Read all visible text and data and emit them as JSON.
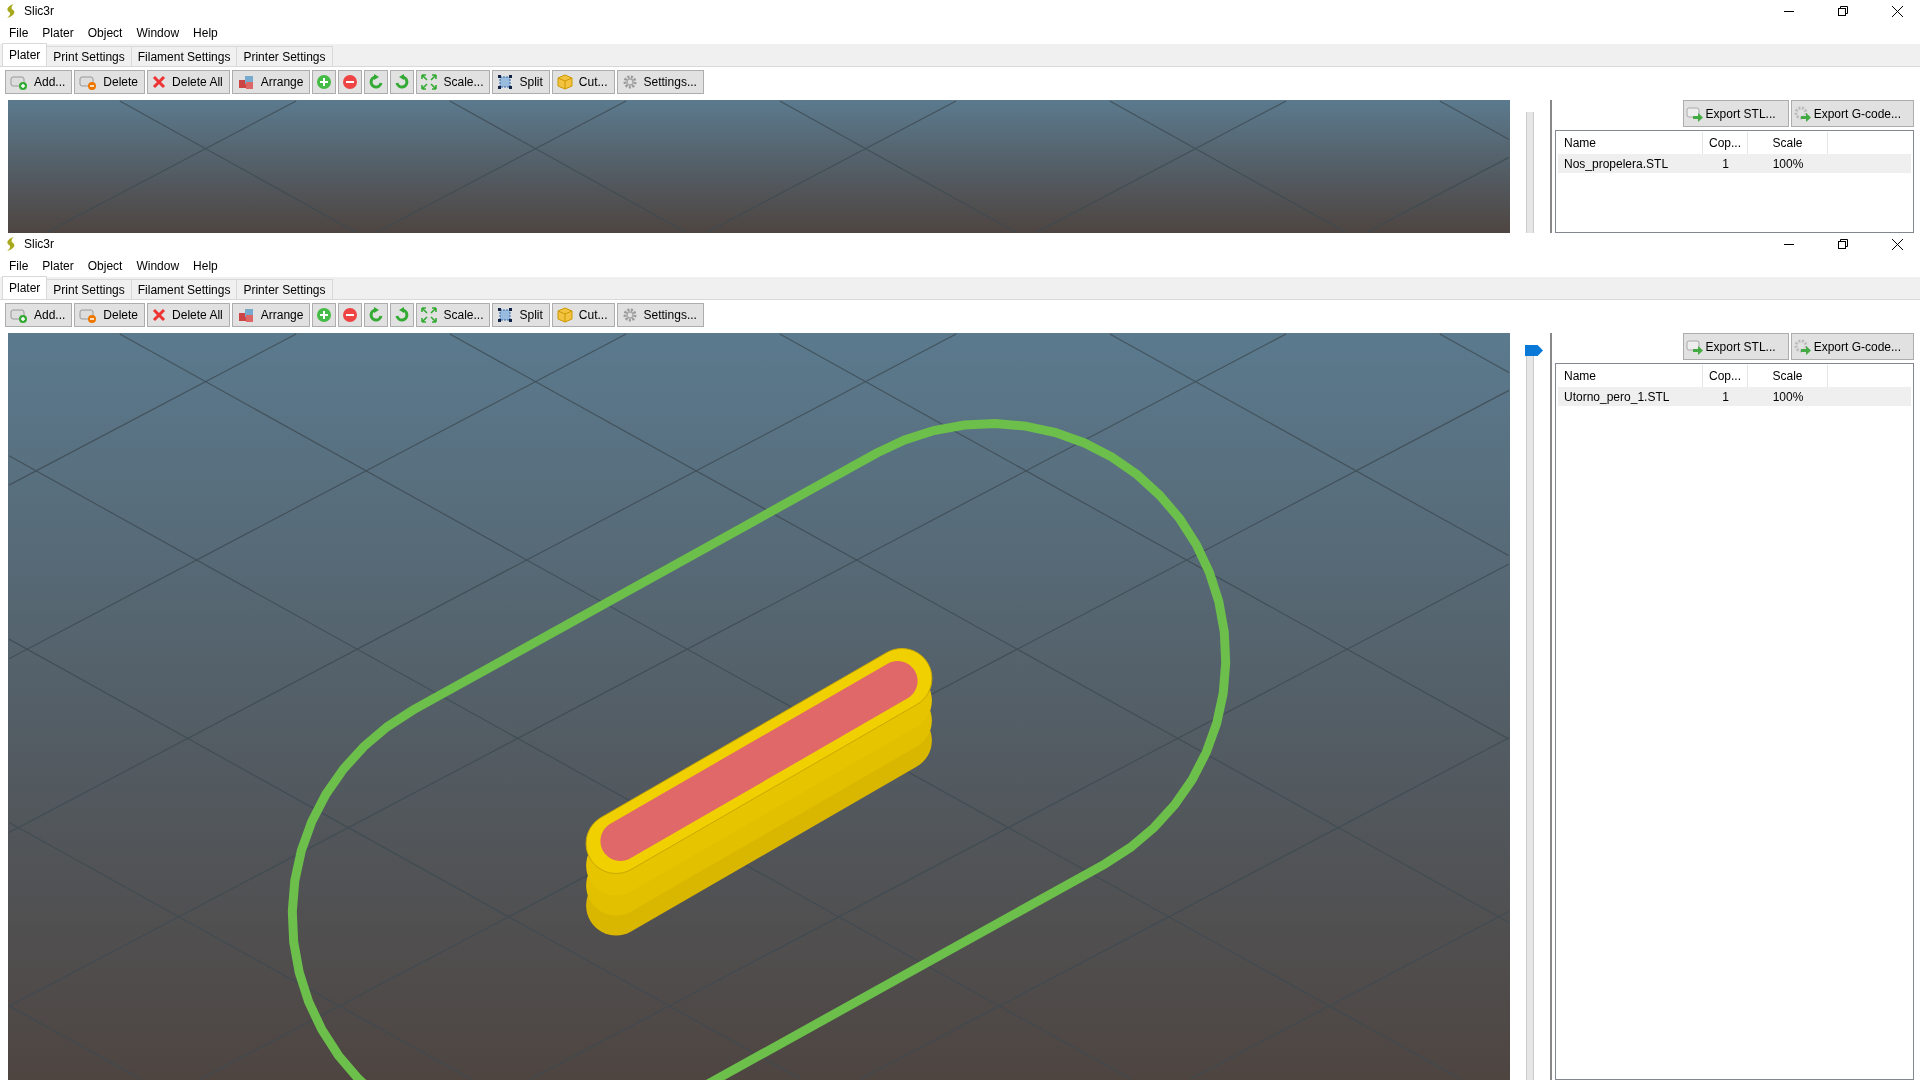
{
  "windows": [
    {
      "title": "Slic3r",
      "menu": [
        "File",
        "Plater",
        "Object",
        "Window",
        "Help"
      ],
      "tabs": [
        {
          "label": "Plater",
          "selected": true
        },
        {
          "label": "Print Settings",
          "selected": false
        },
        {
          "label": "Filament Settings",
          "selected": false
        },
        {
          "label": "Printer Settings",
          "selected": false
        }
      ],
      "toolbar": [
        {
          "kind": "labeled",
          "label": "Add..."
        },
        {
          "kind": "labeled",
          "label": "Delete"
        },
        {
          "kind": "labeled",
          "label": "Delete All"
        },
        {
          "kind": "labeled",
          "label": "Arrange"
        },
        {
          "kind": "icon"
        },
        {
          "kind": "icon"
        },
        {
          "kind": "icon"
        },
        {
          "kind": "icon"
        },
        {
          "kind": "labeled",
          "label": "Scale..."
        },
        {
          "kind": "labeled",
          "label": "Split"
        },
        {
          "kind": "labeled",
          "label": "Cut..."
        },
        {
          "kind": "labeled",
          "label": "Settings..."
        }
      ],
      "has_model": false,
      "export_buttons": [
        "Export STL...",
        "Export G-code..."
      ],
      "objects": {
        "columns": [
          "Name",
          "Cop...",
          "Scale"
        ],
        "rows": [
          [
            "Nos_propelera.STL",
            "1",
            "100%"
          ]
        ]
      }
    },
    {
      "title": "Slic3r",
      "menu": [
        "File",
        "Plater",
        "Object",
        "Window",
        "Help"
      ],
      "tabs": [
        {
          "label": "Plater",
          "selected": true
        },
        {
          "label": "Print Settings",
          "selected": false
        },
        {
          "label": "Filament Settings",
          "selected": false
        },
        {
          "label": "Printer Settings",
          "selected": false
        }
      ],
      "toolbar": [
        {
          "kind": "labeled",
          "label": "Add..."
        },
        {
          "kind": "labeled",
          "label": "Delete"
        },
        {
          "kind": "labeled",
          "label": "Delete All"
        },
        {
          "kind": "labeled",
          "label": "Arrange"
        },
        {
          "kind": "icon"
        },
        {
          "kind": "icon"
        },
        {
          "kind": "icon"
        },
        {
          "kind": "icon"
        },
        {
          "kind": "labeled",
          "label": "Scale..."
        },
        {
          "kind": "labeled",
          "label": "Split"
        },
        {
          "kind": "labeled",
          "label": "Cut..."
        },
        {
          "kind": "labeled",
          "label": "Settings..."
        }
      ],
      "has_model": true,
      "layer_slider": {
        "level": 1
      },
      "export_buttons": [
        "Export STL...",
        "Export G-code..."
      ],
      "objects": {
        "columns": [
          "Name",
          "Cop...",
          "Scale"
        ],
        "rows": [
          [
            "Utorno_pero_1.STL",
            "1",
            "100%"
          ]
        ]
      }
    }
  ]
}
